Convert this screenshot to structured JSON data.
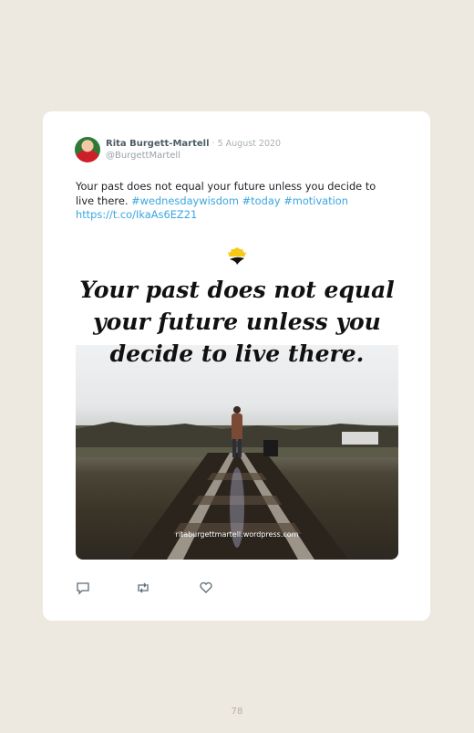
{
  "tweet": {
    "author_name": "Rita Burgett-Martell",
    "separator": " · ",
    "date": "5 August 2020",
    "handle": "@BurgettMartell",
    "text": "Your past does not equal your future unless you decide to live there. ",
    "hashtag1": "#wednesdaywisdom",
    "hashtag2": "#today",
    "hashtag3": "#motivation",
    "link": "https://t.co/IkaAs6EZ21"
  },
  "media": {
    "quote_line1": "Your past does not equal",
    "quote_line2": "your future unless you",
    "quote_line3": "decide to live there.",
    "credit": "ritaburgettmartell.wordpress.com"
  },
  "actions": {
    "reply_icon": "reply-icon",
    "retweet_icon": "retweet-icon",
    "like_icon": "heart-icon"
  },
  "page_number": "78",
  "colors": {
    "page_background": "#ede9e0",
    "link": "#3aa6e0"
  }
}
